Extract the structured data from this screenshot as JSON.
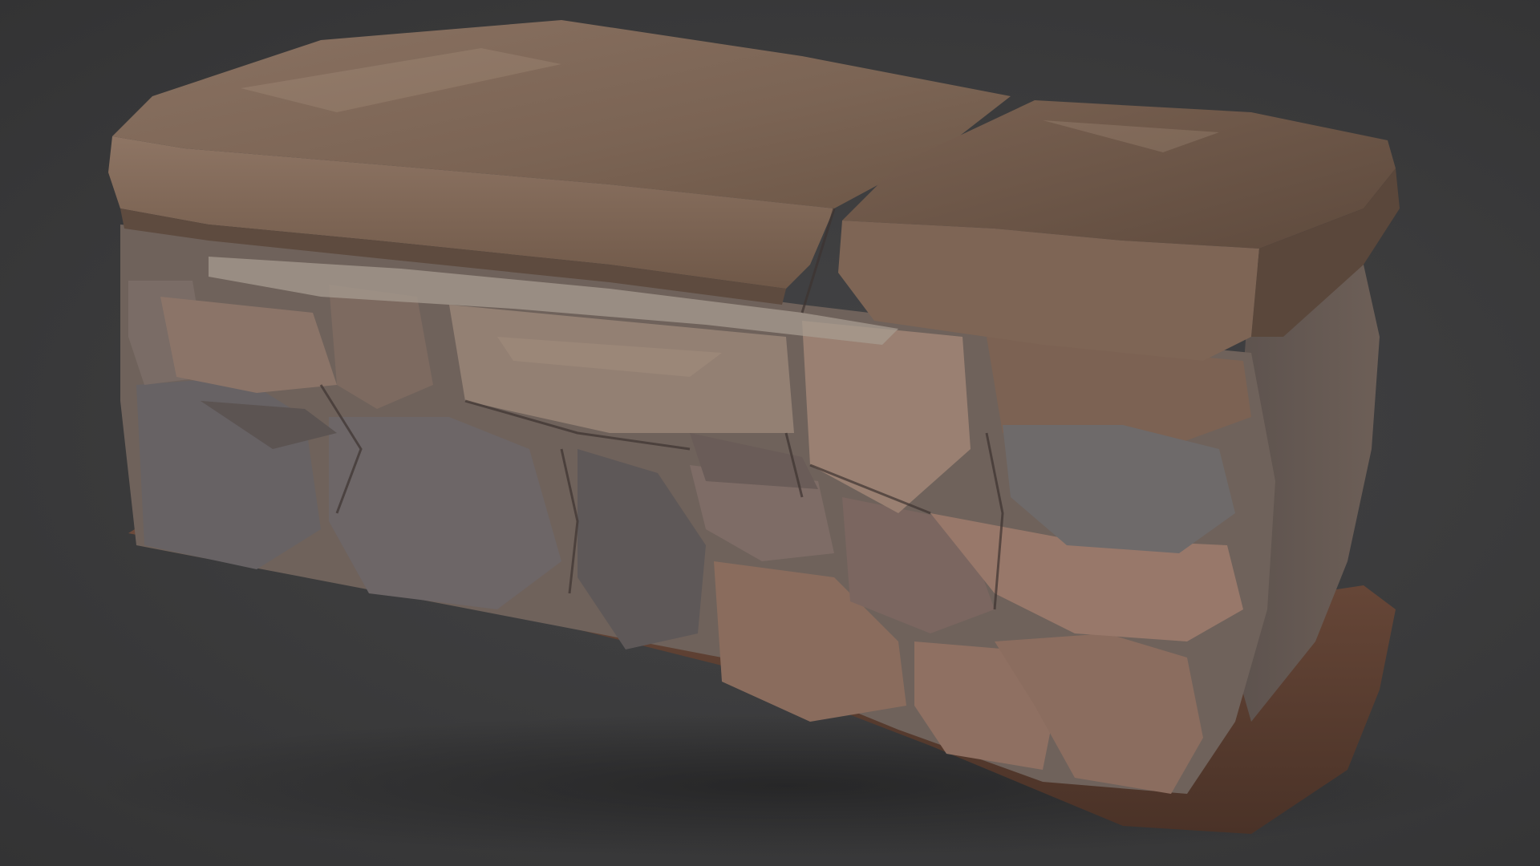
{
  "scene": {
    "subject": "stone-wall-bench-3d-scan",
    "colors": {
      "background": "#3a3a3b",
      "capstone": "#7d6656",
      "capstone_light": "#957c69",
      "capstone_dark": "#5a4638",
      "stone_warm": "#8c6a58",
      "stone_cool": "#6a6767",
      "stone_dark": "#4f4846",
      "mortar": "#a59a8e",
      "soil": "#6b4a3b",
      "soil_dark": "#4e3429"
    }
  }
}
